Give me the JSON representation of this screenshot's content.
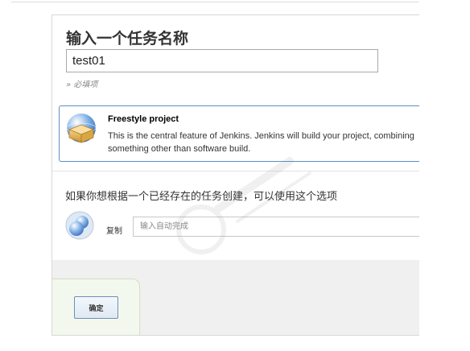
{
  "form": {
    "title": "输入一个任务名称",
    "name_value": "test01",
    "required_hint": "» 必填项"
  },
  "freestyle": {
    "icon": "freestyle-project-icon",
    "title": "Freestyle project",
    "description": "This is the central feature of Jenkins. Jenkins will build your project, combining something other than software build."
  },
  "copy": {
    "heading": "如果你想根据一个已经存在的任务创建，可以使用这个选项",
    "icon": "copy-job-icon",
    "label": "复制",
    "placeholder": "输入自动完成"
  },
  "actions": {
    "ok_label": "确定"
  },
  "colors": {
    "selected_border": "#5b8fc7",
    "ok_panel_bg": "#f3f8ef",
    "bottom_bg": "#f0f0f0"
  }
}
